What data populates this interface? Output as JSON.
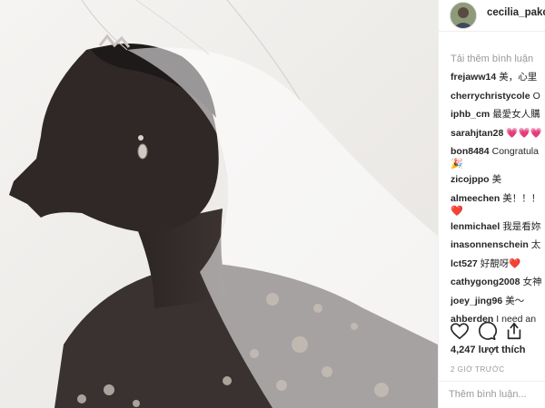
{
  "post": {
    "username": "cecilia_pakc",
    "load_more": "Tải thêm bình luận",
    "comments": [
      {
        "user": "frejaww14",
        "text": "美，心里"
      },
      {
        "user": "cherrychristycole",
        "text": "O"
      },
      {
        "user": "iphb_cm",
        "text": "最愛女人購"
      },
      {
        "user": "sarahjtan28",
        "text": "💗💗💗"
      },
      {
        "user": "bon8484",
        "text": "Congratula",
        "cont": "🎉"
      },
      {
        "user": "zicojppo",
        "text": "美"
      },
      {
        "user": "almeechen",
        "text": "美！！！",
        "cont": "❤️"
      },
      {
        "user": "lenmichael",
        "text": "我是看妳"
      },
      {
        "user": "inasonnenschein",
        "text": "太"
      },
      {
        "user": "lct527",
        "text": "好靚呀❤️"
      },
      {
        "user": "cathygong2008",
        "text": "女神"
      },
      {
        "user": "joey_jing96",
        "text": "美～"
      },
      {
        "user": "ahberden",
        "text": "I need an"
      }
    ],
    "likes": "4,247 lượt thích",
    "time": "2 GIỜ TRƯỚC",
    "add_comment_placeholder": "Thêm bình luận..."
  },
  "icons": [
    "heart-icon",
    "comment-icon",
    "share-icon"
  ],
  "colors": {
    "text": "#262626",
    "muted": "#999999",
    "border": "#efefef",
    "heart": "#ed4956"
  }
}
